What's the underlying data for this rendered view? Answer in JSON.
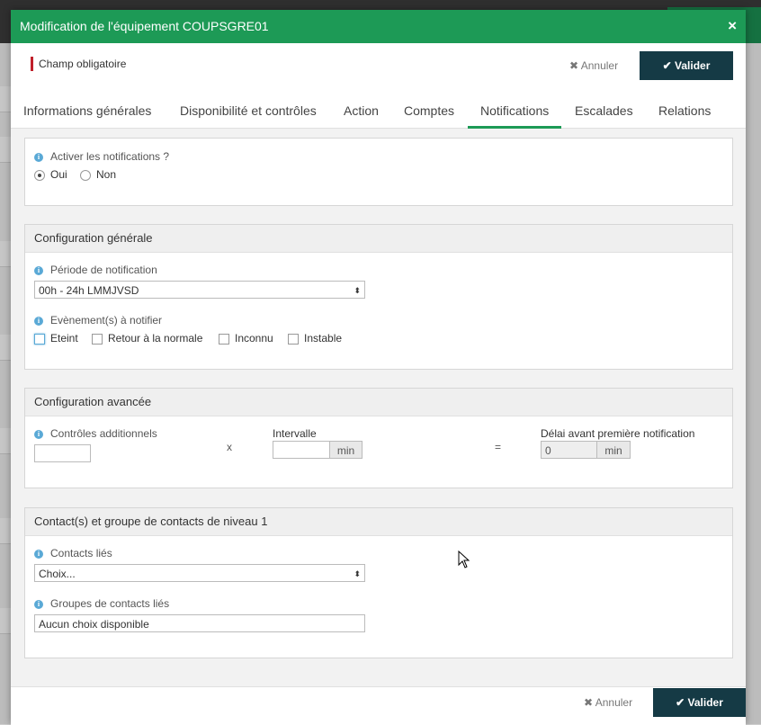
{
  "modal": {
    "title": "Modification de l'équipement COUPSGRE01",
    "close_glyph": "×",
    "required_note": "Champ obligatoire",
    "cancel_label": "Annuler",
    "validate_label": "Valider",
    "cancel_icon": "times-icon",
    "validate_icon": "check-icon"
  },
  "tabs": [
    {
      "label": "Informations générales"
    },
    {
      "label": "Disponibilité et contrôles"
    },
    {
      "label": "Action"
    },
    {
      "label": "Comptes"
    },
    {
      "label": "Notifications",
      "active": true
    },
    {
      "label": "Escalades"
    },
    {
      "label": "Relations"
    }
  ],
  "notifications": {
    "enable_label": "Activer les notifications ?",
    "options": [
      "Oui",
      "Non"
    ],
    "selected": "Oui"
  },
  "general": {
    "title": "Configuration générale",
    "period_label": "Période de notification",
    "period_value": "00h - 24h LMMJVSD",
    "events_label": "Evènement(s) à notifier",
    "events": [
      "Eteint",
      "Retour à la normale",
      "Inconnu",
      "Instable"
    ]
  },
  "advanced": {
    "title": "Configuration avancée",
    "controls_label": "Contrôles additionnels",
    "controls_value": "",
    "multiply_sign": "x",
    "interval_label": "Intervalle",
    "interval_value": "",
    "interval_unit": "min",
    "equals_sign": "=",
    "delay_label": "Délai avant première notification",
    "delay_value": "0",
    "delay_unit": "min"
  },
  "contacts": {
    "title": "Contact(s) et groupe de contacts de niveau 1",
    "contacts_label": "Contacts liés",
    "contacts_value": "Choix...",
    "groups_label": "Groupes de contacts liés",
    "groups_value": "Aucun choix disponible"
  },
  "colors": {
    "header_green": "#1d9a56",
    "validate_bg": "#153a45",
    "required_red": "#c0202a",
    "info_blue": "#5aa9d6"
  }
}
